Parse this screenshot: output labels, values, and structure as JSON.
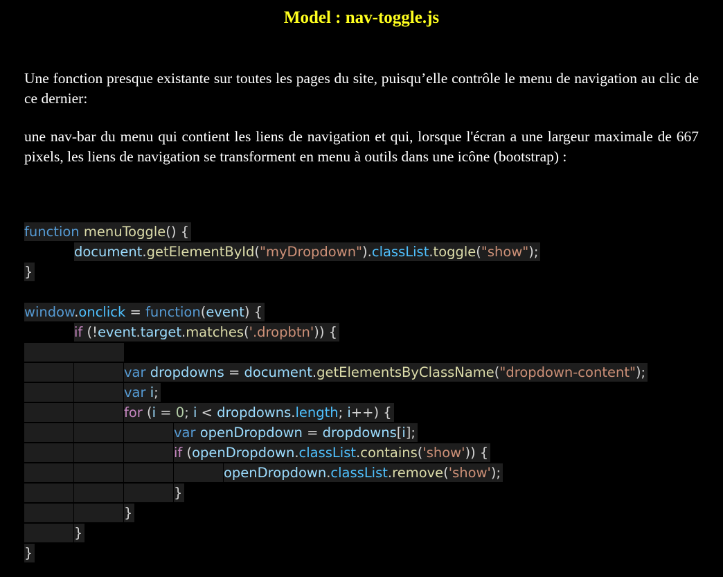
{
  "title": "Model : nav-toggle.js",
  "paragraphs": [
    "Une fonction presque existante sur toutes les pages du site, puisqu’elle contrôle le menu de navigation  au clic de ce dernier:",
    "une nav-bar du menu qui contient les liens de navigation et qui, lorsque l'écran a une largeur maximale de 667 pixels, les liens de navigation se transforment en menu à outils dans une icône (bootstrap) :"
  ],
  "code_lines": [
    "function menuToggle() {",
    "document.getElementById(\"myDropdown\").classList.toggle(\"show\");",
    "}",
    "",
    "window.onclick = function(event) {",
    "if (!event.target.matches('.dropbtn')) {",
    "",
    "var dropdowns = document.getElementsByClassName(\"dropdown-content\");",
    "var i;",
    "for (i = 0; i < dropdowns.length; i++) {",
    "var openDropdown = dropdowns[i];",
    "if (openDropdown.classList.contains('show')) {",
    "openDropdown.classList.remove('show');",
    "}",
    "}",
    "}",
    "}"
  ],
  "syntax_colors": {
    "background": "#1e1e1e",
    "keyword": "#569cd6",
    "control": "#c586c0",
    "function": "#dcdcaa",
    "string": "#ce9178",
    "number": "#b5cea8",
    "variable": "#9cdcfe",
    "property": "#4fc1ff",
    "plain": "#d4d4d4"
  }
}
